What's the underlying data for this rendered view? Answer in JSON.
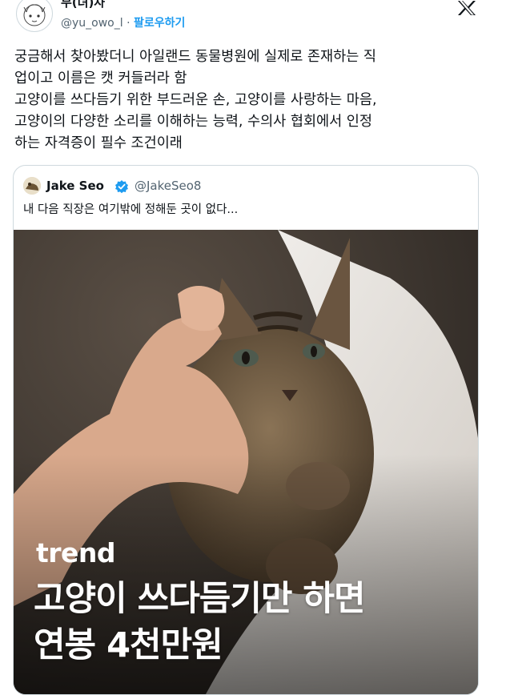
{
  "author": {
    "display_name": "무(녀)사",
    "handle": "@yu_owo_l",
    "separator": "·",
    "follow_label": "팔로우하기"
  },
  "icons": {
    "platform": "x-logo-icon",
    "verified": "verified-badge-icon",
    "avatar": "cartoon-avatar"
  },
  "tweet": {
    "text": "궁금해서 찾아봤더니 아일랜드 동물병원에 실제로 존재하는 직\n업이고 이름은 캣 커들러라 함\n고양이를 쓰다듬기 위한 부드러운 손, 고양이를 사랑하는 마음,\n고양이의 다양한 소리를 이해하는 능력, 수의사 협회에서 인정\n하는 자격증이 필수 조건이래"
  },
  "quoted": {
    "name": "Jake Seo",
    "handle": "@JakeSeo8",
    "text": "내 다음 직장은 여기밖에 정해둔 곳이 없다...",
    "media": {
      "tag": "trend",
      "headline_line1": "고양이 쓰다듬기만 하면",
      "headline_line2": "연봉 4천만원"
    }
  },
  "colors": {
    "accent": "#1d9bf0",
    "text": "#0f1419",
    "secondary": "#536471",
    "border": "#cfd9de"
  }
}
